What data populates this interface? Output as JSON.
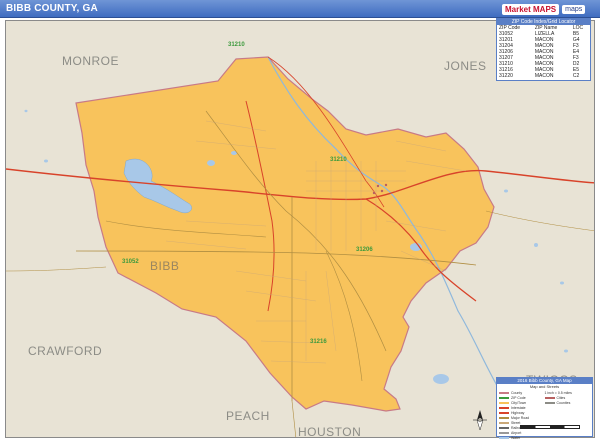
{
  "header": {
    "title": "BIBB COUNTY, GA",
    "brand": "Market MAPS",
    "brand_secondary": "maps"
  },
  "map": {
    "neighbors": [
      {
        "name": "MONROE"
      },
      {
        "name": "JONES"
      },
      {
        "name": "CRAWFORD"
      },
      {
        "name": "TWIGGS"
      },
      {
        "name": "PEACH"
      },
      {
        "name": "HOUSTON"
      }
    ],
    "county_name": "BIBB",
    "colors": {
      "county_fill": "#f8c35c",
      "county_border": "#c87a86",
      "background": "#e8e3d5",
      "water": "#a8c8e8",
      "highway": "#d8432a",
      "road": "#b08e42",
      "zip_label": "#3d9a3d",
      "title_bar": "#4a78c8"
    },
    "zip_labels": [
      "31210",
      "31052",
      "31216",
      "31206",
      "31210"
    ]
  },
  "zip_index": {
    "title": "ZIP Code Index/Grid Locator",
    "columns": [
      "ZIP Code",
      "ZIP Name",
      "LOC"
    ],
    "rows": [
      [
        "31052",
        "LIZELLA",
        "B5"
      ],
      [
        "31201",
        "MACON",
        "G4"
      ],
      [
        "31204",
        "MACON",
        "F3"
      ],
      [
        "31206",
        "MACON",
        "E4"
      ],
      [
        "31207",
        "MACON",
        "F3"
      ],
      [
        "31210",
        "MACON",
        "D2"
      ],
      [
        "31216",
        "MACON",
        "E5"
      ],
      [
        "31220",
        "MACON",
        "C2"
      ]
    ]
  },
  "legend": {
    "title": "2016 Bibb County, GA Map",
    "subtitle": "Map and Streets",
    "left_items": [
      "County",
      "ZIP Code",
      "City/Town",
      "Interstate",
      "Highway",
      "Major Road",
      "Street",
      "Railroad",
      "Airport",
      "Water"
    ],
    "right_items": [
      "1 inch = 0.5 miles",
      "Cities",
      "Counties"
    ]
  }
}
